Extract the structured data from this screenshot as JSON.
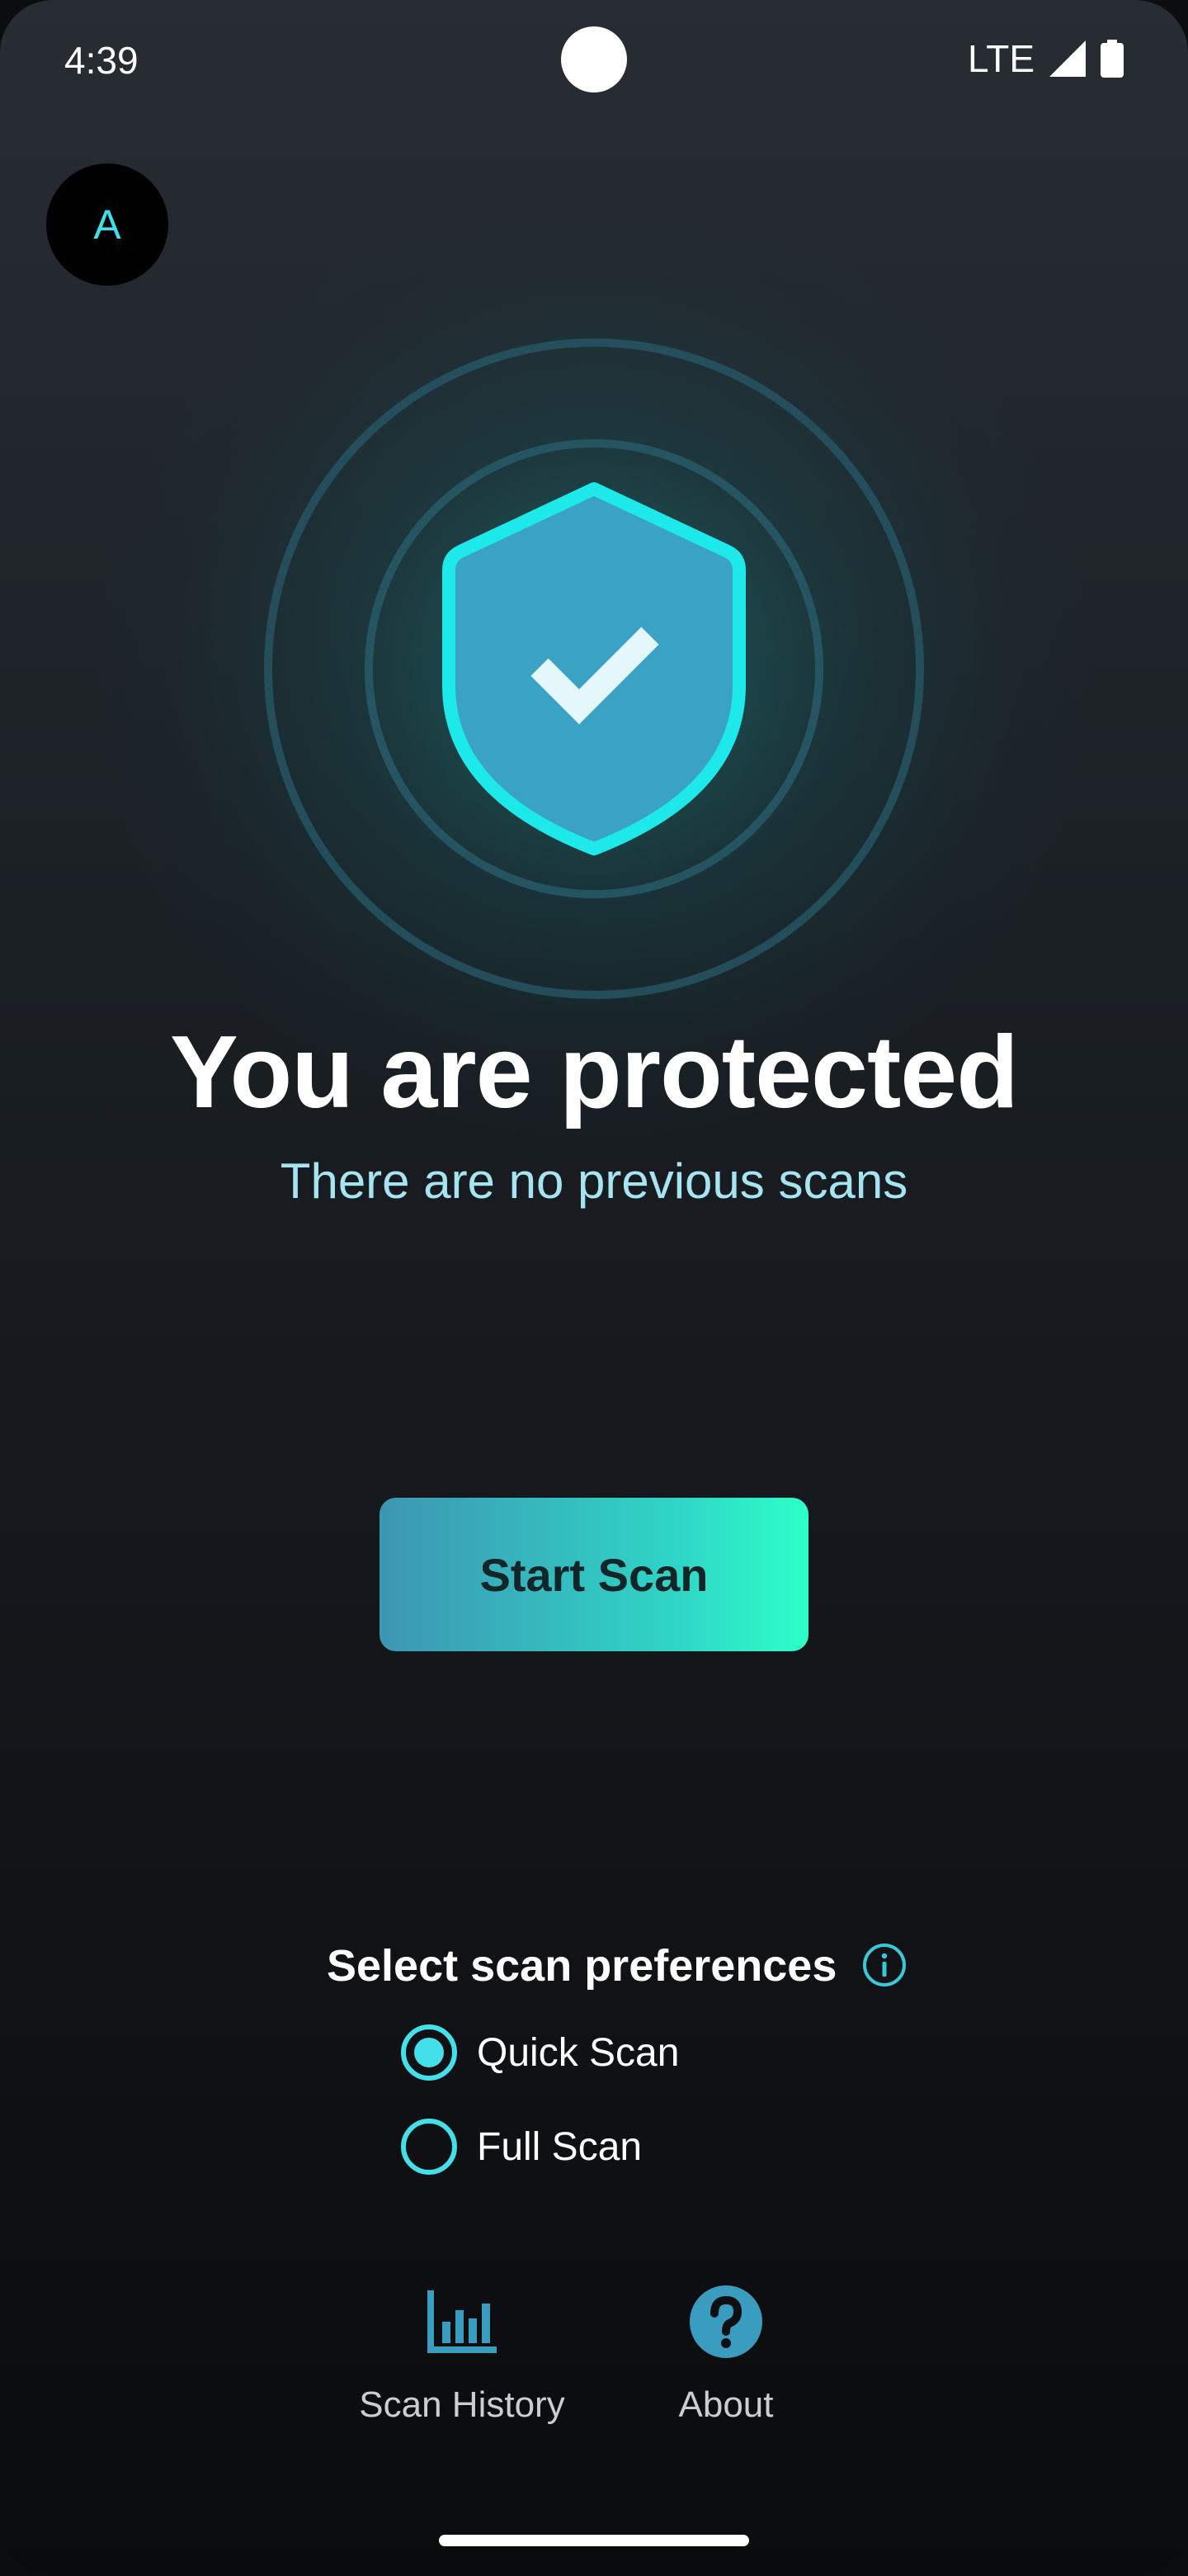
{
  "status_bar": {
    "time": "4:39",
    "network": "LTE",
    "icons": [
      "signal-icon",
      "battery-icon"
    ]
  },
  "avatar": {
    "initial": "A"
  },
  "hero": {
    "icon": "shield-check-icon",
    "title": "You are protected",
    "subtitle": "There are no previous scans"
  },
  "actions": {
    "start_scan_label": "Start Scan"
  },
  "preferences": {
    "heading": "Select scan preferences",
    "info_icon": "info-icon",
    "options": [
      {
        "label": "Quick Scan",
        "selected": true
      },
      {
        "label": "Full Scan",
        "selected": false
      }
    ]
  },
  "bottom_nav": {
    "items": [
      {
        "label": "Scan History",
        "icon": "bar-chart-icon"
      },
      {
        "label": "About",
        "icon": "help-circle-icon"
      }
    ]
  },
  "colors": {
    "accent": "#44e0ea",
    "shield_fill": "#3aa3c5",
    "shield_stroke": "#1de8ea",
    "button_gradient_start": "#3d96b3",
    "button_gradient_end": "#2effc8",
    "subtitle": "#a6e4f2",
    "nav_icon": "#3a9dc0"
  }
}
